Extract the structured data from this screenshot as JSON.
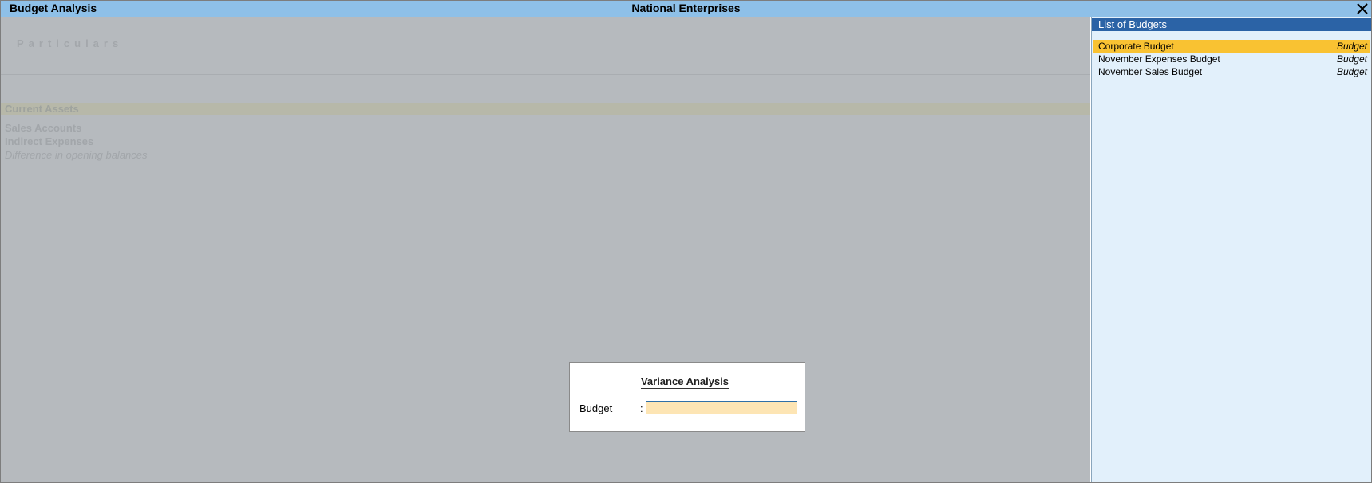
{
  "titlebar": {
    "app_title": "Budget Analysis",
    "company_name": "National Enterprises",
    "close_icon": "close-icon"
  },
  "report": {
    "column_header": "Particulars",
    "rows": [
      {
        "label": "Current Assets",
        "style": "highlighted-bold"
      },
      {
        "label": "Sales Accounts",
        "style": "bold"
      },
      {
        "label": "Indirect Expenses",
        "style": "bold"
      },
      {
        "label": "Difference in opening balances",
        "style": "italic"
      }
    ]
  },
  "dialog": {
    "title": "Variance Analysis",
    "budget_label": "Budget",
    "separator": ":",
    "budget_value": ""
  },
  "list_panel": {
    "title": "List of Budgets",
    "items": [
      {
        "name": "Corporate Budget",
        "type": "Budget",
        "selected": true
      },
      {
        "name": "November Expenses Budget",
        "type": "Budget",
        "selected": false
      },
      {
        "name": "November Sales Budget",
        "type": "Budget",
        "selected": false
      }
    ]
  },
  "colors": {
    "titlebar": "#8ec0e8",
    "list_header": "#2b63a6",
    "selection": "#f9c232",
    "input_background": "#fde5b4",
    "panel_background": "#e2f0fb",
    "dimmed_background": "#b6babe"
  }
}
